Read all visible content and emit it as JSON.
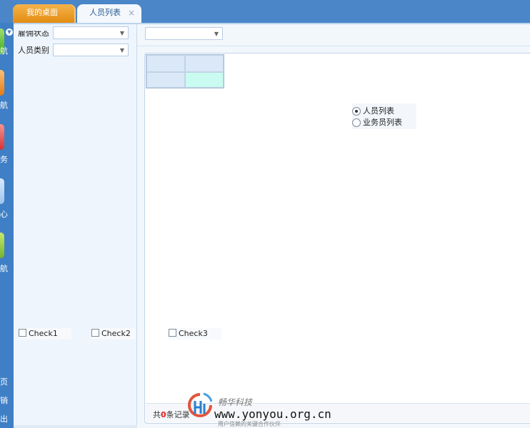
{
  "tabs": [
    {
      "label": "我的桌面"
    },
    {
      "label": "人员列表",
      "close": "×"
    }
  ],
  "nav": {
    "labels": [
      "航",
      "航",
      "务",
      "心",
      "航"
    ],
    "bottom_labels": [
      "页",
      "销",
      "出"
    ]
  },
  "filters": {
    "status_label": "雇佣状态",
    "category_label": "人员类别"
  },
  "radios": [
    "人员列表",
    "业务员列表"
  ],
  "checks": [
    "Check1",
    "Check2",
    "Check3"
  ],
  "footer": {
    "prefix": "共",
    "count": "0",
    "suffix": "条记录"
  },
  "watermark": {
    "cn": "畅华科技",
    "url": "www.yonyou.org.cn",
    "sub": "用户信赖的关键合作伙伴"
  },
  "colors": {
    "topbar": "#4a86c8",
    "tab_active": "#f4f8fd",
    "tab_orange": "#e38c12",
    "panel": "#eef5fd",
    "grid_header": "#dbe8f7",
    "grid_selected": "#c9fbf0",
    "count_red": "#e32020"
  }
}
